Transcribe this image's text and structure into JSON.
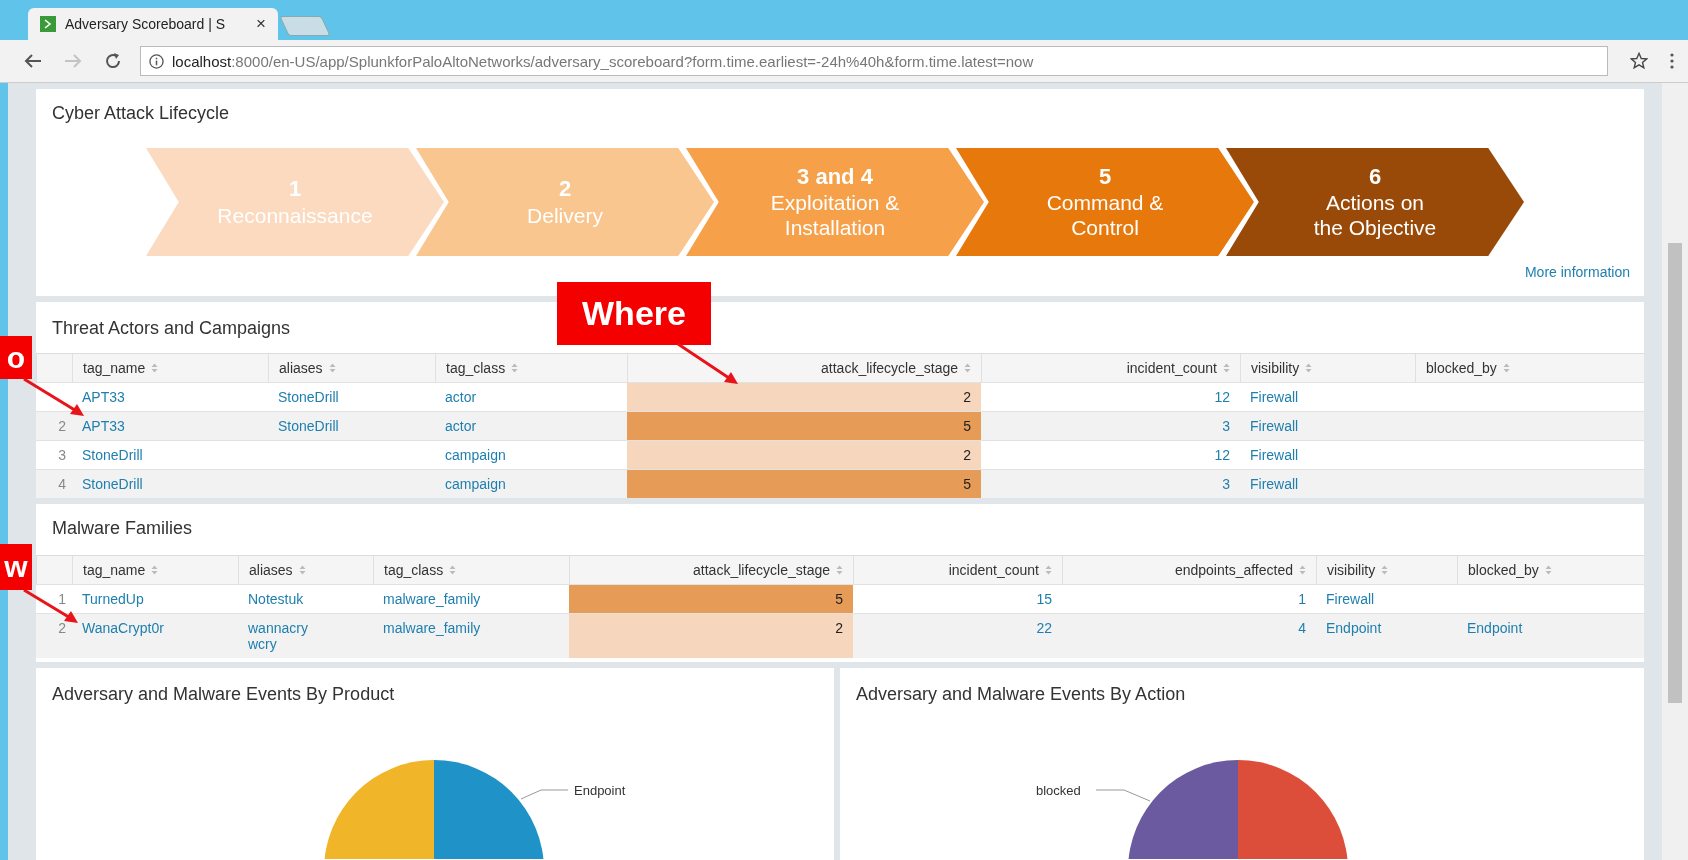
{
  "browser": {
    "tab_title": "Adversary Scoreboard | S",
    "tab_close": "×",
    "url_host": "localhost",
    "url_rest": ":8000/en-US/app/SplunkforPaloAltoNetworks/adversary_scoreboard?form.time.earliest=-24h%40h&form.time.latest=now"
  },
  "lifecycle": {
    "title": "Cyber Attack Lifecycle",
    "link": "More information",
    "stages": [
      {
        "number": "1",
        "lines": [
          "Reconnaissance"
        ],
        "color": "#fbdabf"
      },
      {
        "number": "2",
        "lines": [
          "Delivery"
        ],
        "color": "#f8c68e"
      },
      {
        "number": "3 and 4",
        "lines": [
          "Exploitation &",
          "Installation"
        ],
        "color": "#f6a04a"
      },
      {
        "number": "5",
        "lines": [
          "Command &",
          "Control"
        ],
        "color": "#e7780c"
      },
      {
        "number": "6",
        "lines": [
          "Actions on",
          "the Objective"
        ],
        "color": "#994a08"
      }
    ]
  },
  "threat_table": {
    "title": "Threat Actors and Campaigns",
    "columns": [
      {
        "label": "tag_name",
        "numeric": false
      },
      {
        "label": "aliases",
        "numeric": false
      },
      {
        "label": "tag_class",
        "numeric": false
      },
      {
        "label": "attack_lifecycle_stage",
        "numeric": true
      },
      {
        "label": "incident_count",
        "numeric": true
      },
      {
        "label": "visibility",
        "numeric": false
      },
      {
        "label": "blocked_by",
        "numeric": false
      }
    ],
    "rows": [
      {
        "tag_name": "APT33",
        "aliases": "StoneDrill",
        "tag_class": "actor",
        "attack_lifecycle_stage": "2",
        "incident_count": "12",
        "visibility": "Firewall",
        "color": "#f6d6bc"
      },
      {
        "number": "2",
        "tag_name": "APT33",
        "aliases": "StoneDrill",
        "tag_class": "actor",
        "attack_lifecycle_stage": "5",
        "incident_count": "3",
        "visibility": "Firewall",
        "color": "#e69b57"
      },
      {
        "number": "3",
        "tag_name": "StoneDrill",
        "tag_class": "campaign",
        "attack_lifecycle_stage": "2",
        "incident_count": "12",
        "visibility": "Firewall",
        "color": "#f6d6bc"
      },
      {
        "number": "4",
        "tag_name": "StoneDrill",
        "tag_class": "campaign",
        "attack_lifecycle_stage": "5",
        "incident_count": "3",
        "visibility": "Firewall",
        "color": "#e69b57"
      }
    ]
  },
  "malware_table": {
    "title": "Malware Families",
    "columns": [
      {
        "label": "tag_name",
        "numeric": false
      },
      {
        "label": "aliases",
        "numeric": false
      },
      {
        "label": "tag_class",
        "numeric": false
      },
      {
        "label": "attack_lifecycle_stage",
        "numeric": true
      },
      {
        "label": "incident_count",
        "numeric": true
      },
      {
        "label": "endpoints_affected",
        "numeric": true
      },
      {
        "label": "visibility",
        "numeric": false
      },
      {
        "label": "blocked_by",
        "numeric": false
      }
    ],
    "rows": [
      {
        "number": "1",
        "tag_name": "TurnedUp",
        "aliases": "Notestuk",
        "tag_class": "malware_family",
        "attack_lifecycle_stage": "5",
        "incident_count": "15",
        "endpoints_affected": "1",
        "visibility": "Firewall",
        "color": "#e69b57"
      },
      {
        "number": "2",
        "tag_name": "WanaCrypt0r",
        "aliases": "wannacry\nwcry",
        "tag_class": "malware_family",
        "attack_lifecycle_stage": "2",
        "incident_count": "22",
        "endpoints_affected": "4",
        "visibility": "Endpoint",
        "blocked_by": "Endpoint",
        "color": "#f6d6bc"
      }
    ]
  },
  "charts": [
    {
      "title": "Adversary and Malware Events By Product",
      "label": "Endpoint",
      "slices": [
        {
          "color": "#f0b528"
        },
        {
          "color": "#1f93c7"
        }
      ]
    },
    {
      "title": "Adversary and Malware Events By Action",
      "label": "blocked",
      "slices": [
        {
          "color": "#6c5aa0"
        },
        {
          "color": "#dc4e3a"
        }
      ]
    }
  ],
  "annotations": [
    {
      "text": "Where"
    },
    {
      "text": "o"
    },
    {
      "text": "w"
    }
  ]
}
